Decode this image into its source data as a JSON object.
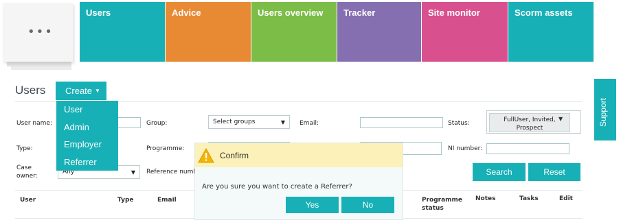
{
  "menu": {
    "icon": "ellipsis"
  },
  "tiles": [
    {
      "label": "Users",
      "color": "#17b0b6"
    },
    {
      "label": "Advice",
      "color": "#e88a34"
    },
    {
      "label": "Users overview",
      "color": "#7bbd47"
    },
    {
      "label": "Tracker",
      "color": "#866fb1"
    },
    {
      "label": "Site monitor",
      "color": "#d9508e"
    },
    {
      "label": "Scorm assets",
      "color": "#17b0b6"
    }
  ],
  "page": {
    "title": "Users"
  },
  "create": {
    "label": "Create"
  },
  "create_menu": [
    "User",
    "Admin",
    "Employer",
    "Referrer"
  ],
  "support": {
    "label": "Support"
  },
  "filters": {
    "user_name": "User name:",
    "group": "Group:",
    "group_value": "Select groups",
    "email": "Email:",
    "status": "Status:",
    "status_value_line1": "FullUser, Invited,",
    "status_value_line2": "Prospect",
    "type": "Type:",
    "programme": "Programme:",
    "ni_number": "NI number:",
    "case_owner_line1": "Case",
    "case_owner_line2": "owner:",
    "case_owner_value": "Any",
    "reference": "Reference numb"
  },
  "actions": {
    "search": "Search",
    "reset": "Reset"
  },
  "columns": {
    "user": "User",
    "type": "Type",
    "email": "Email",
    "programme_line1": "Programme",
    "programme_line2": "status",
    "notes": "Notes",
    "tasks": "Tasks",
    "edit": "Edit"
  },
  "confirm": {
    "title": "Confirm",
    "message": "Are you sure you want to create a Referrer?",
    "yes": "Yes",
    "no": "No"
  },
  "colors": {
    "accent": "#17b0b6",
    "modal_header": "#fbf1b9",
    "warning": "#f5b400"
  }
}
